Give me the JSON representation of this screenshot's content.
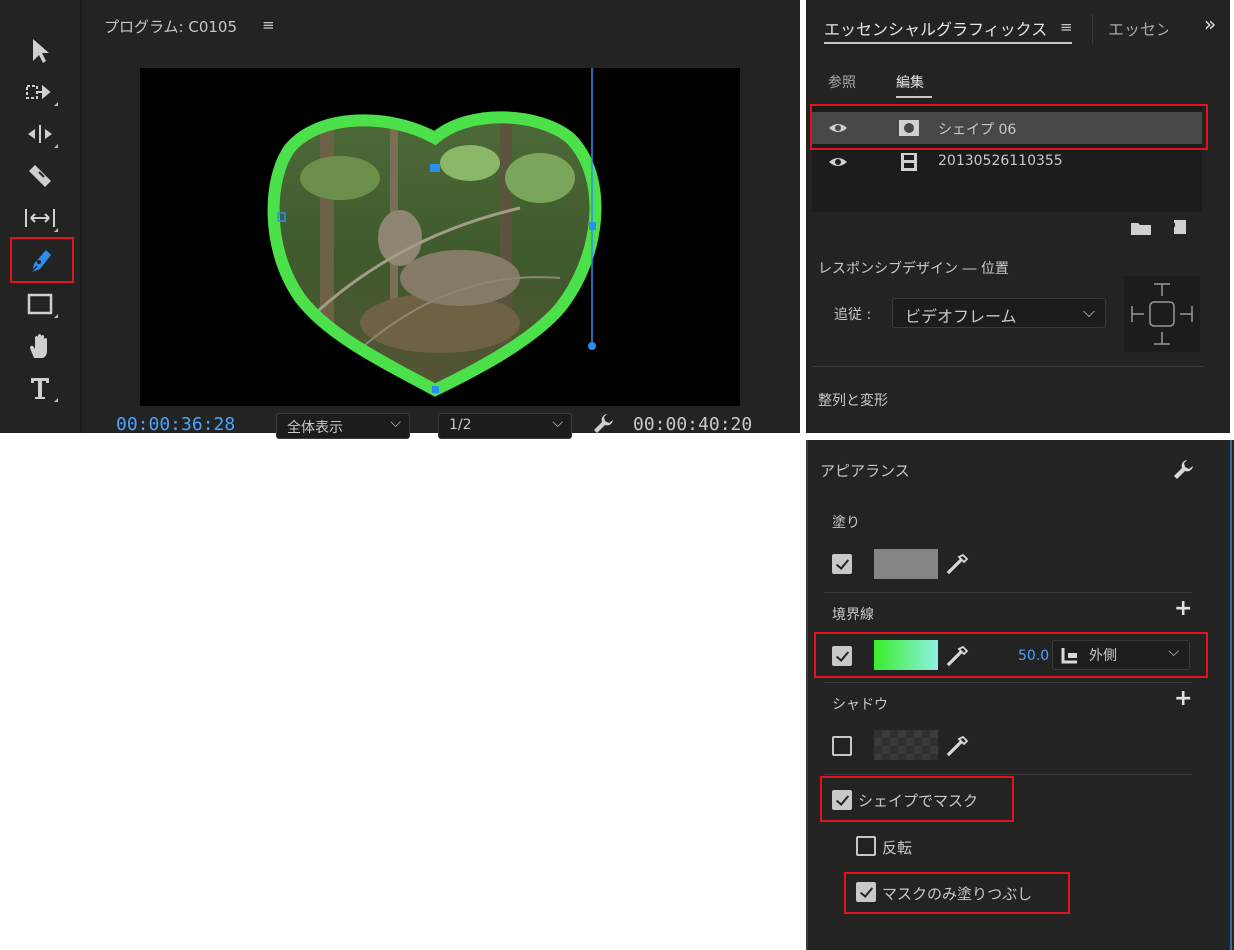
{
  "toolbar": {
    "tools": [
      "selection-tool",
      "track-select-forward-tool",
      "ripple-edit-tool",
      "razor-tool",
      "slip-tool",
      "pen-tool",
      "rectangle-tool",
      "hand-tool",
      "type-tool"
    ],
    "active_tool": "pen-tool"
  },
  "monitor": {
    "title": "プログラム: C0105",
    "menu_icon": "≡",
    "current_time": "00:00:36:28",
    "zoom_value": "全体表示",
    "resolution_value": "1/2",
    "duration": "00:00:40:20",
    "accent_color": "#4aa3ff",
    "stroke_color": "#4ce04a"
  },
  "eg": {
    "tab_active": "エッセンシャルグラフィックス",
    "tab_active_menu": "≡",
    "tab_other": "エッセン",
    "overflow": "»",
    "subtab_browse": "参照",
    "subtab_edit": "編集",
    "layers": [
      {
        "name": "シェイプ 06",
        "type": "shape"
      },
      {
        "name": "20130526110355",
        "type": "video"
      }
    ],
    "responsive_label": "レスポンシブデザイン ― 位置",
    "follow_label": "追従 :",
    "follow_value": "ビデオフレーム",
    "align_label": "整列と変形"
  },
  "appearance": {
    "title": "アピアランス",
    "fill_label": "塗り",
    "fill_checked": true,
    "fill_color": "#858585",
    "stroke_label": "境界線",
    "stroke_checked": true,
    "stroke_gradient_from": "#3aee2a",
    "stroke_gradient_to": "#8ff0e4",
    "stroke_width": "50.0",
    "stroke_position": "外側",
    "shadow_label": "シャドウ",
    "shadow_checked": false,
    "mask_with_shape_label": "シェイプでマスク",
    "mask_with_shape_checked": true,
    "invert_label": "反転",
    "invert_checked": false,
    "fill_mask_only_label": "マスクのみ塗りつぶし",
    "fill_mask_only_checked": true
  }
}
